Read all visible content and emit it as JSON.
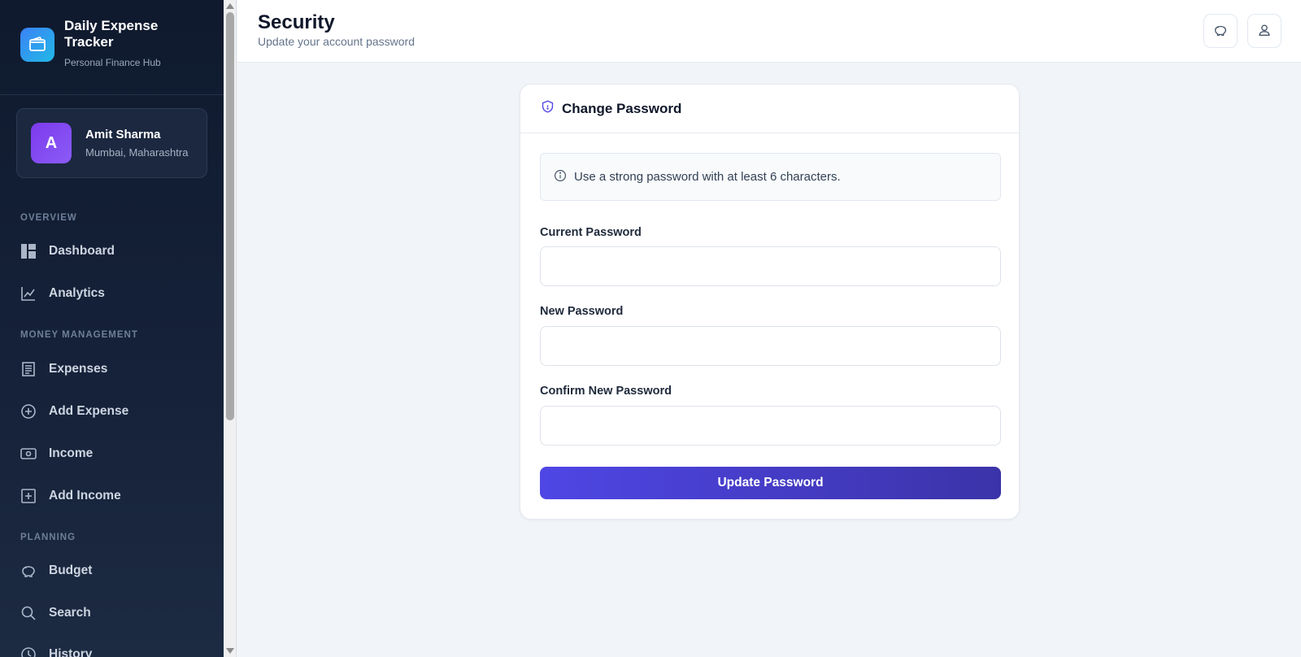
{
  "brand": {
    "title": "Daily Expense Tracker",
    "subtitle": "Personal Finance Hub"
  },
  "profile": {
    "initial": "A",
    "name": "Amit Sharma",
    "location": "Mumbai, Maharashtra"
  },
  "sidebar": {
    "sections": [
      {
        "label": "OVERVIEW"
      },
      {
        "label": "MONEY MANAGEMENT"
      },
      {
        "label": "PLANNING"
      }
    ],
    "items": [
      {
        "label": "Dashboard",
        "icon": "dashboard-icon"
      },
      {
        "label": "Analytics",
        "icon": "chart-line-icon"
      },
      {
        "label": "Expenses",
        "icon": "receipt-icon"
      },
      {
        "label": "Add Expense",
        "icon": "plus-circle-icon"
      },
      {
        "label": "Income",
        "icon": "money-icon"
      },
      {
        "label": "Add Income",
        "icon": "plus-square-icon"
      },
      {
        "label": "Budget",
        "icon": "piggy-bank-icon"
      },
      {
        "label": "Search",
        "icon": "search-icon"
      },
      {
        "label": "History",
        "icon": "clock-icon"
      }
    ]
  },
  "header": {
    "title": "Security",
    "subtitle": "Update your account password",
    "buttons": [
      {
        "icon": "piggy-bank-icon"
      },
      {
        "icon": "user-icon"
      }
    ]
  },
  "card": {
    "title": "Change Password",
    "info": "Use a strong password with at least 6 characters.",
    "fields": [
      {
        "label": "Current Password",
        "value": ""
      },
      {
        "label": "New Password",
        "value": ""
      },
      {
        "label": "Confirm New Password",
        "value": ""
      }
    ],
    "submit_label": "Update Password"
  },
  "colors": {
    "accent": "#4f46e5",
    "sidebar_bg": "#0f1a2e",
    "page_bg": "#f1f4f8"
  }
}
